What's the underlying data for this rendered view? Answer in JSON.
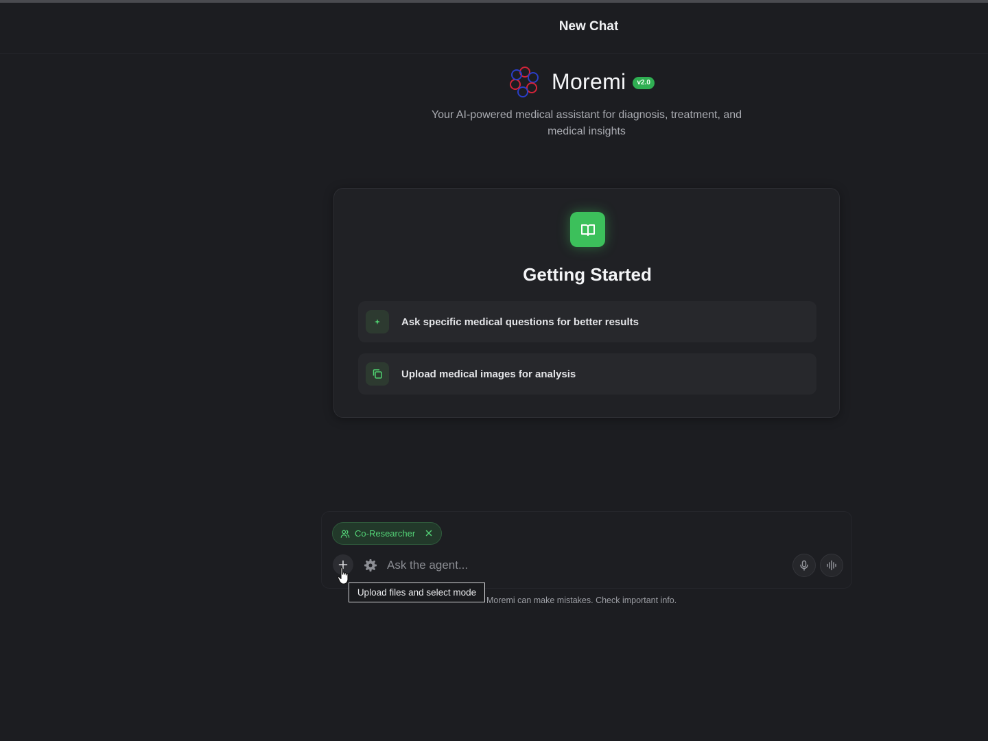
{
  "header": {
    "title": "New Chat"
  },
  "brand": {
    "name": "Moremi",
    "version_badge": "v2.0",
    "subtitle": "Your AI-powered medical assistant for diagnosis, treatment, and medical insights"
  },
  "getting_started": {
    "title": "Getting Started",
    "tips": [
      {
        "icon": "sparkle-icon",
        "label": "Ask specific medical questions for better results"
      },
      {
        "icon": "copy-icon",
        "label": "Upload medical images for analysis"
      }
    ]
  },
  "composer": {
    "mode_chip": {
      "icon": "users-icon",
      "label": "Co-Researcher"
    },
    "input": {
      "placeholder": "Ask the agent...",
      "value": ""
    },
    "tooltip": "Upload files and select mode",
    "disclaimer": "Moremi can make mistakes. Check important info."
  },
  "colors": {
    "accent_green": "#3cc05b",
    "background": "#1c1d21",
    "card": "#202125"
  }
}
